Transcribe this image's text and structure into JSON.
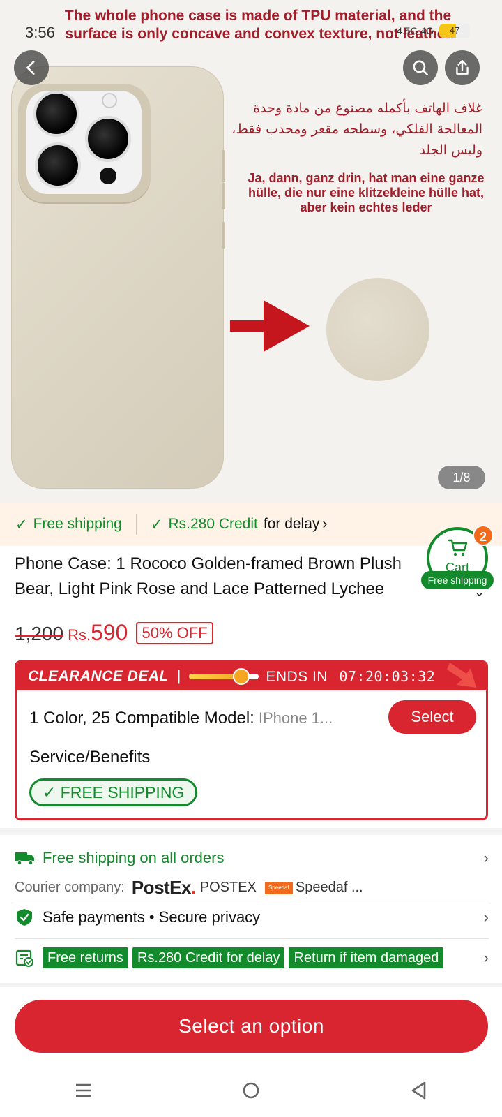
{
  "status_bar": {
    "time": "3:56",
    "network": "4.5G 4G",
    "battery": "47"
  },
  "hero": {
    "caption": "The whole phone case is made of TPU material, and the surface is only concave and convex texture, not leather",
    "arabic_text": "غلاف الهاتف بأكمله مصنوع من مادة وحدة المعالجة الفلكي، وسطحه مقعر ومحدب فقط، وليس الجلد",
    "german_text": "Ja, dann, ganz drin, hat man eine ganze hülle, die nur eine klitzekleine hülle hat, aber kein echtes leder",
    "page_counter": "1/8"
  },
  "ship_banner": {
    "free_shipping": "Free shipping",
    "credit": "Rs.280 Credit",
    "credit_suffix": "for delay"
  },
  "cart": {
    "label": "Cart",
    "count": "2",
    "ship_label": "Free shipping"
  },
  "product": {
    "title": "Phone Case: 1 Rococo Golden-framed Brown Plush Bear, Light Pink Rose and Lace Patterned Lychee",
    "old_price": "1,200",
    "currency": "Rs.",
    "price": "590",
    "discount": "50% OFF"
  },
  "deal": {
    "title": "CLEARANCE DEAL",
    "separator": "|",
    "ends_label": "ENDS IN",
    "countdown": "07:20:03:32",
    "progress": 0.75,
    "variant_label": "1 Color, 25 Compatible Model:",
    "variant_value": "IPhone 1...",
    "select_label": "Select",
    "service_label": "Service/Benefits",
    "free_shipping_pill": "FREE SHIPPING"
  },
  "info": {
    "shipping_all": "Free shipping on all orders",
    "courier_label": "Courier company:",
    "postex_logo": "PostEx",
    "postex_name": "POSTEX",
    "speedaf_logo": "Speedaf",
    "speedaf_name": "Speedaf ...",
    "safe_payments": "Safe payments • Secure privacy",
    "tags": [
      "Free returns",
      "Rs.280 Credit for delay",
      "Return if item damaged"
    ]
  },
  "cta": {
    "label": "Select an option"
  },
  "colors": {
    "accent": "#d9252f",
    "green": "#138a2b",
    "banner_bg": "#fff3e8"
  }
}
